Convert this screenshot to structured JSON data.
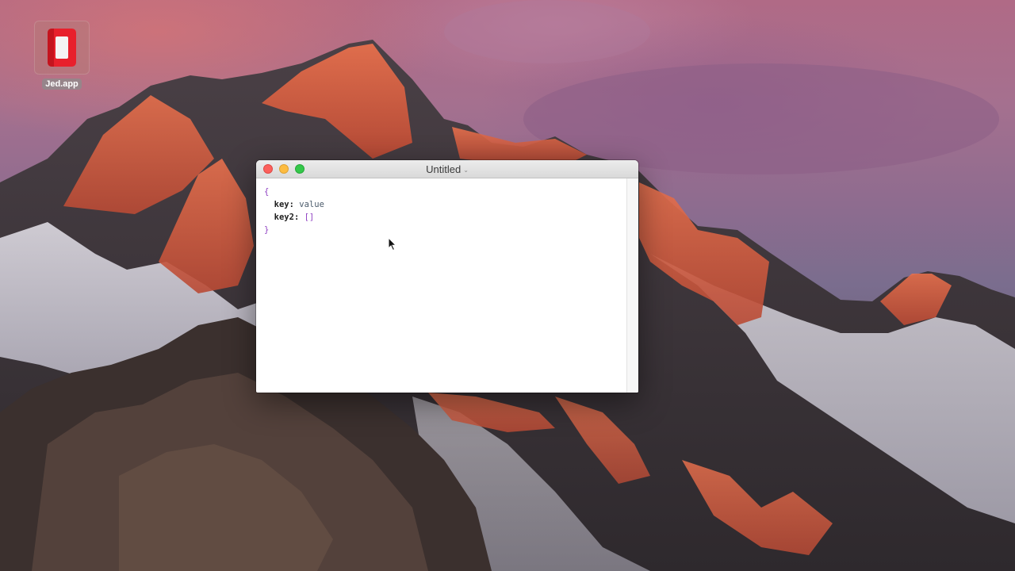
{
  "desktop": {
    "icon_label": "Jed.app"
  },
  "window": {
    "title": "Untitled",
    "editor_lines": {
      "open_brace": "{",
      "key1": "key",
      "val1": "value",
      "key2": "key2",
      "val2": "[]",
      "close_brace": "}"
    }
  },
  "colors": {
    "close": "#fc605c",
    "minimize": "#fdbc40",
    "maximize": "#34c84a",
    "brace": "#8f3fc2"
  },
  "icons": [
    "jed-app-icon",
    "mouse-pointer-icon",
    "chevron-down-icon"
  ]
}
